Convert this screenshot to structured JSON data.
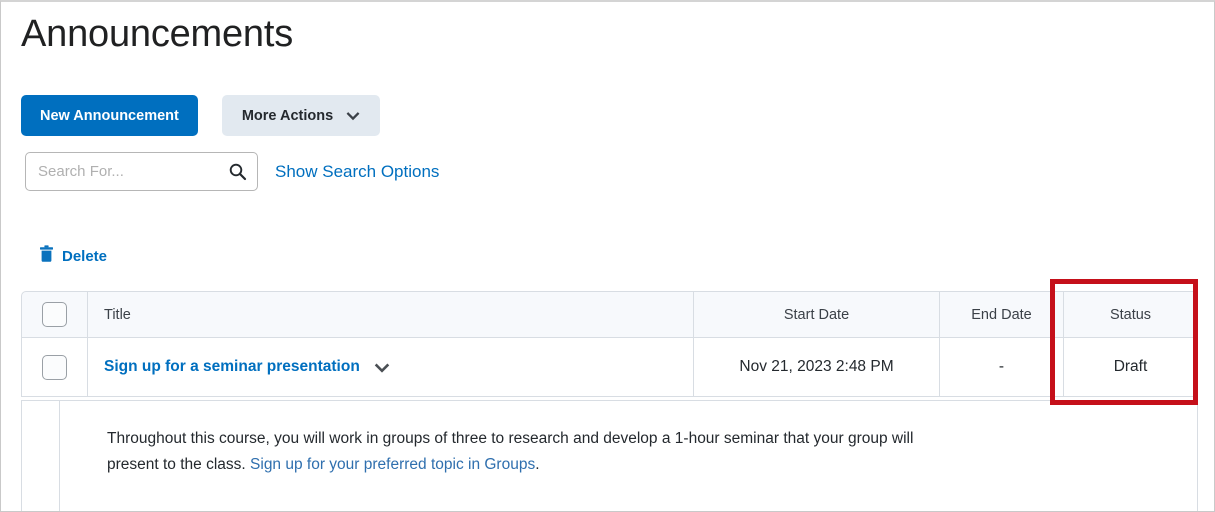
{
  "page": {
    "title": "Announcements"
  },
  "toolbar": {
    "new_announcement_label": "New Announcement",
    "more_actions_label": "More Actions"
  },
  "search": {
    "value": "",
    "placeholder": "Search For...",
    "show_options_label": "Show Search Options"
  },
  "bulk_actions": {
    "delete_label": "Delete"
  },
  "table": {
    "columns": [
      "Title",
      "Start Date",
      "End Date",
      "Status"
    ],
    "rows": [
      {
        "title": "Sign up for a seminar presentation",
        "start_date": "Nov 21, 2023 2:48 PM",
        "end_date": "-",
        "status": "Draft"
      }
    ]
  },
  "expanded_body": {
    "text_before_link": "Throughout this course, you will work in groups of three to research and develop a 1-hour seminar that your group will present to the class. ",
    "link_text": "Sign up for your preferred topic in Groups",
    "text_after_link": "."
  },
  "annotation": {
    "highlight_color": "#c5101a",
    "target": "status-column"
  },
  "colors": {
    "primary_blue": "#006fbf",
    "link_blue": "#006fbf",
    "secondary_button": "#e2e9f0",
    "table_header_bg": "#f7f9fc",
    "border": "#d8dde3"
  }
}
